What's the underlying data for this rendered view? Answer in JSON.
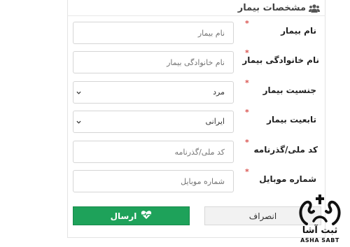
{
  "section": {
    "title": "مشخصات بیمار",
    "icon": "users-icon"
  },
  "fields": [
    {
      "label": "نام بیمار",
      "required": true,
      "type": "text",
      "placeholder": "نام بیمار",
      "value": ""
    },
    {
      "label": "نام خانوادگی بیمار",
      "required": true,
      "type": "text",
      "placeholder": "نام خانوادگی بیمار",
      "value": ""
    },
    {
      "label": "جنسیت بیمار",
      "required": true,
      "type": "select",
      "value": "مرد"
    },
    {
      "label": "تابعیت بیمار",
      "required": true,
      "type": "select",
      "value": "ایرانی"
    },
    {
      "label": "کد ملی/گذرنامه",
      "required": true,
      "type": "text",
      "placeholder": "کد ملی/گذرنامه",
      "value": ""
    },
    {
      "label": "شماره موبایل",
      "required": true,
      "type": "text",
      "placeholder": "شماره موبایل",
      "value": ""
    }
  ],
  "required_mark": "*",
  "buttons": {
    "send_label": "ارسال",
    "send_icon": "heart-pulse-icon",
    "cancel_label": "انصراف"
  },
  "brand": {
    "name": "ثبت آشا",
    "latin": "ASHA SABT"
  },
  "colors": {
    "send": "#1ea25a",
    "required": "#d9534f",
    "cancel": "#f2f2f2"
  }
}
